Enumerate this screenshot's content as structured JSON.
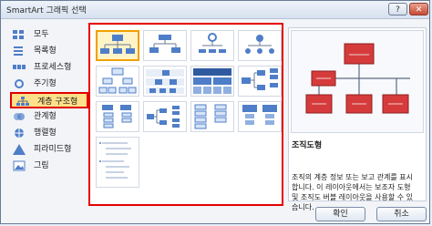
{
  "window": {
    "title": "SmartArt 그래픽 선택"
  },
  "controls": {
    "help": "?",
    "close": "✕"
  },
  "categories": [
    {
      "label": "모두"
    },
    {
      "label": "목록형"
    },
    {
      "label": "프로세스형"
    },
    {
      "label": "주기형"
    },
    {
      "label": "계층 구조형"
    },
    {
      "label": "관계형"
    },
    {
      "label": "행렬형"
    },
    {
      "label": "피라미드형"
    },
    {
      "label": "그림"
    }
  ],
  "selected_category": "계층 구조형",
  "preview": {
    "title": "조직도형",
    "description": "조직의 계층 정보 또는 보고 관계를 표시합니다. 이 레이아웃에서는 보조자 도형 및 조직도 버블 레이아웃을 사용할 수 있습니다."
  },
  "buttons": {
    "ok": "확인",
    "cancel": "취소"
  },
  "colors": {
    "accent": "#e60000",
    "selected_bg": "#ffe18a",
    "shape_blue": "#4f7ec8",
    "shape_red": "#d63b3b"
  }
}
